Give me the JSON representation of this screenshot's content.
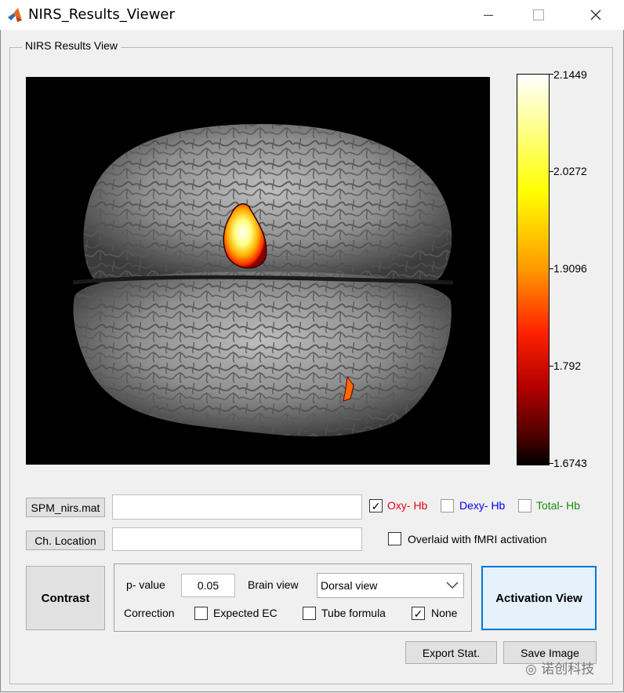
{
  "window": {
    "title": "NIRS_Results_Viewer",
    "minimize_icon": "minimize-icon",
    "maximize_icon": "maximize-icon",
    "close_icon": "close-icon"
  },
  "panel": {
    "title": "NIRS Results View"
  },
  "colorbar": {
    "labels": [
      "2.1449",
      "2.0272",
      "1.9096",
      "1.792",
      "1.6743"
    ],
    "colormap": "hot"
  },
  "brain_view": {
    "selected_view": "Dorsal view"
  },
  "file_row": {
    "button": "SPM_nirs.mat",
    "value": ""
  },
  "location_row": {
    "button": "Ch. Location",
    "value": ""
  },
  "hb_options": {
    "oxy": {
      "label": "Oxy- Hb",
      "checked": true,
      "color": "#e8001c"
    },
    "dexy": {
      "label": "Dexy- Hb",
      "checked": false,
      "color": "#0000ee"
    },
    "total": {
      "label": "Total- Hb",
      "checked": false,
      "color": "#138a13"
    }
  },
  "overlay": {
    "label": "Overlaid with fMRI activation",
    "checked": false
  },
  "contrast_button": "Contrast",
  "settings": {
    "p_value_label": "p- value",
    "p_value": "0.05",
    "brain_view_label": "Brain view",
    "brain_view_value": "Dorsal view",
    "correction_label": "Correction",
    "expected_ec": {
      "label": "Expected EC",
      "checked": false
    },
    "tube_formula": {
      "label": "Tube formula",
      "checked": false
    },
    "none": {
      "label": "None",
      "checked": true
    }
  },
  "activation_button": "Activation View",
  "export_button": "Export Stat.",
  "save_button": "Save Image",
  "watermark": "诺创科技"
}
